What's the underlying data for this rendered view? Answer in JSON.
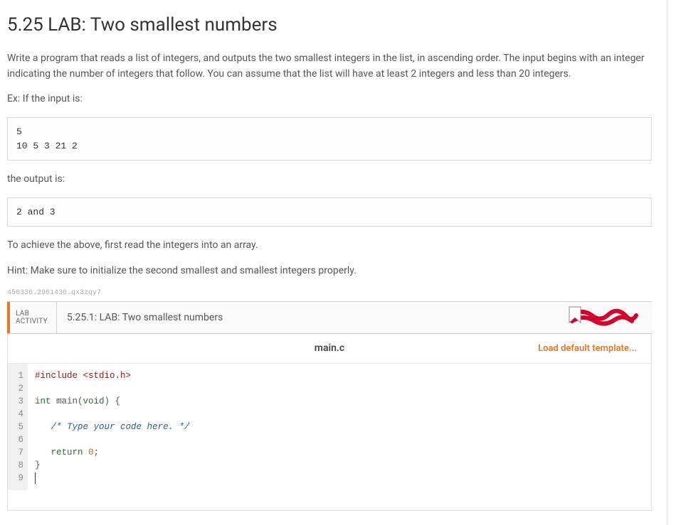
{
  "title": "5.25 LAB: Two smallest numbers",
  "description": "Write a program that reads a list of integers, and outputs the two smallest integers in the list, in ascending order. The input begins with an integer indicating the number of integers that follow. You can assume that the list will have at least 2 integers and less than 20 integers.",
  "example_intro": "Ex: If the input is:",
  "example_input": "5\n10 5 3 21 2",
  "output_intro": "the output is:",
  "example_output": "2 and 3",
  "instruction1": "To achieve the above, first read the integers into an array.",
  "instruction2": "Hint: Make sure to initialize the second smallest and smallest integers properly.",
  "small_id": "450336.2961436.qx3zqy7",
  "activity": {
    "label_line1": "LAB",
    "label_line2": "ACTIVITY",
    "number_title": "5.25.1: LAB: Two smallest numbers"
  },
  "editor": {
    "filename": "main.c",
    "load_template": "Load default template...",
    "lines": {
      "l1": "#include <stdio.h>",
      "l2": "",
      "l3_a": "int",
      "l3_b": " main(",
      "l3_c": "void",
      "l3_d": ") {",
      "l4": "",
      "l5": "   /* Type your code here. */",
      "l6": "",
      "l7_a": "   ",
      "l7_b": "return",
      "l7_c": " ",
      "l7_d": "0",
      "l7_e": ";",
      "l8": "}",
      "l9": ""
    },
    "line_numbers": [
      "1",
      "2",
      "3",
      "4",
      "5",
      "6",
      "7",
      "8",
      "9"
    ]
  }
}
